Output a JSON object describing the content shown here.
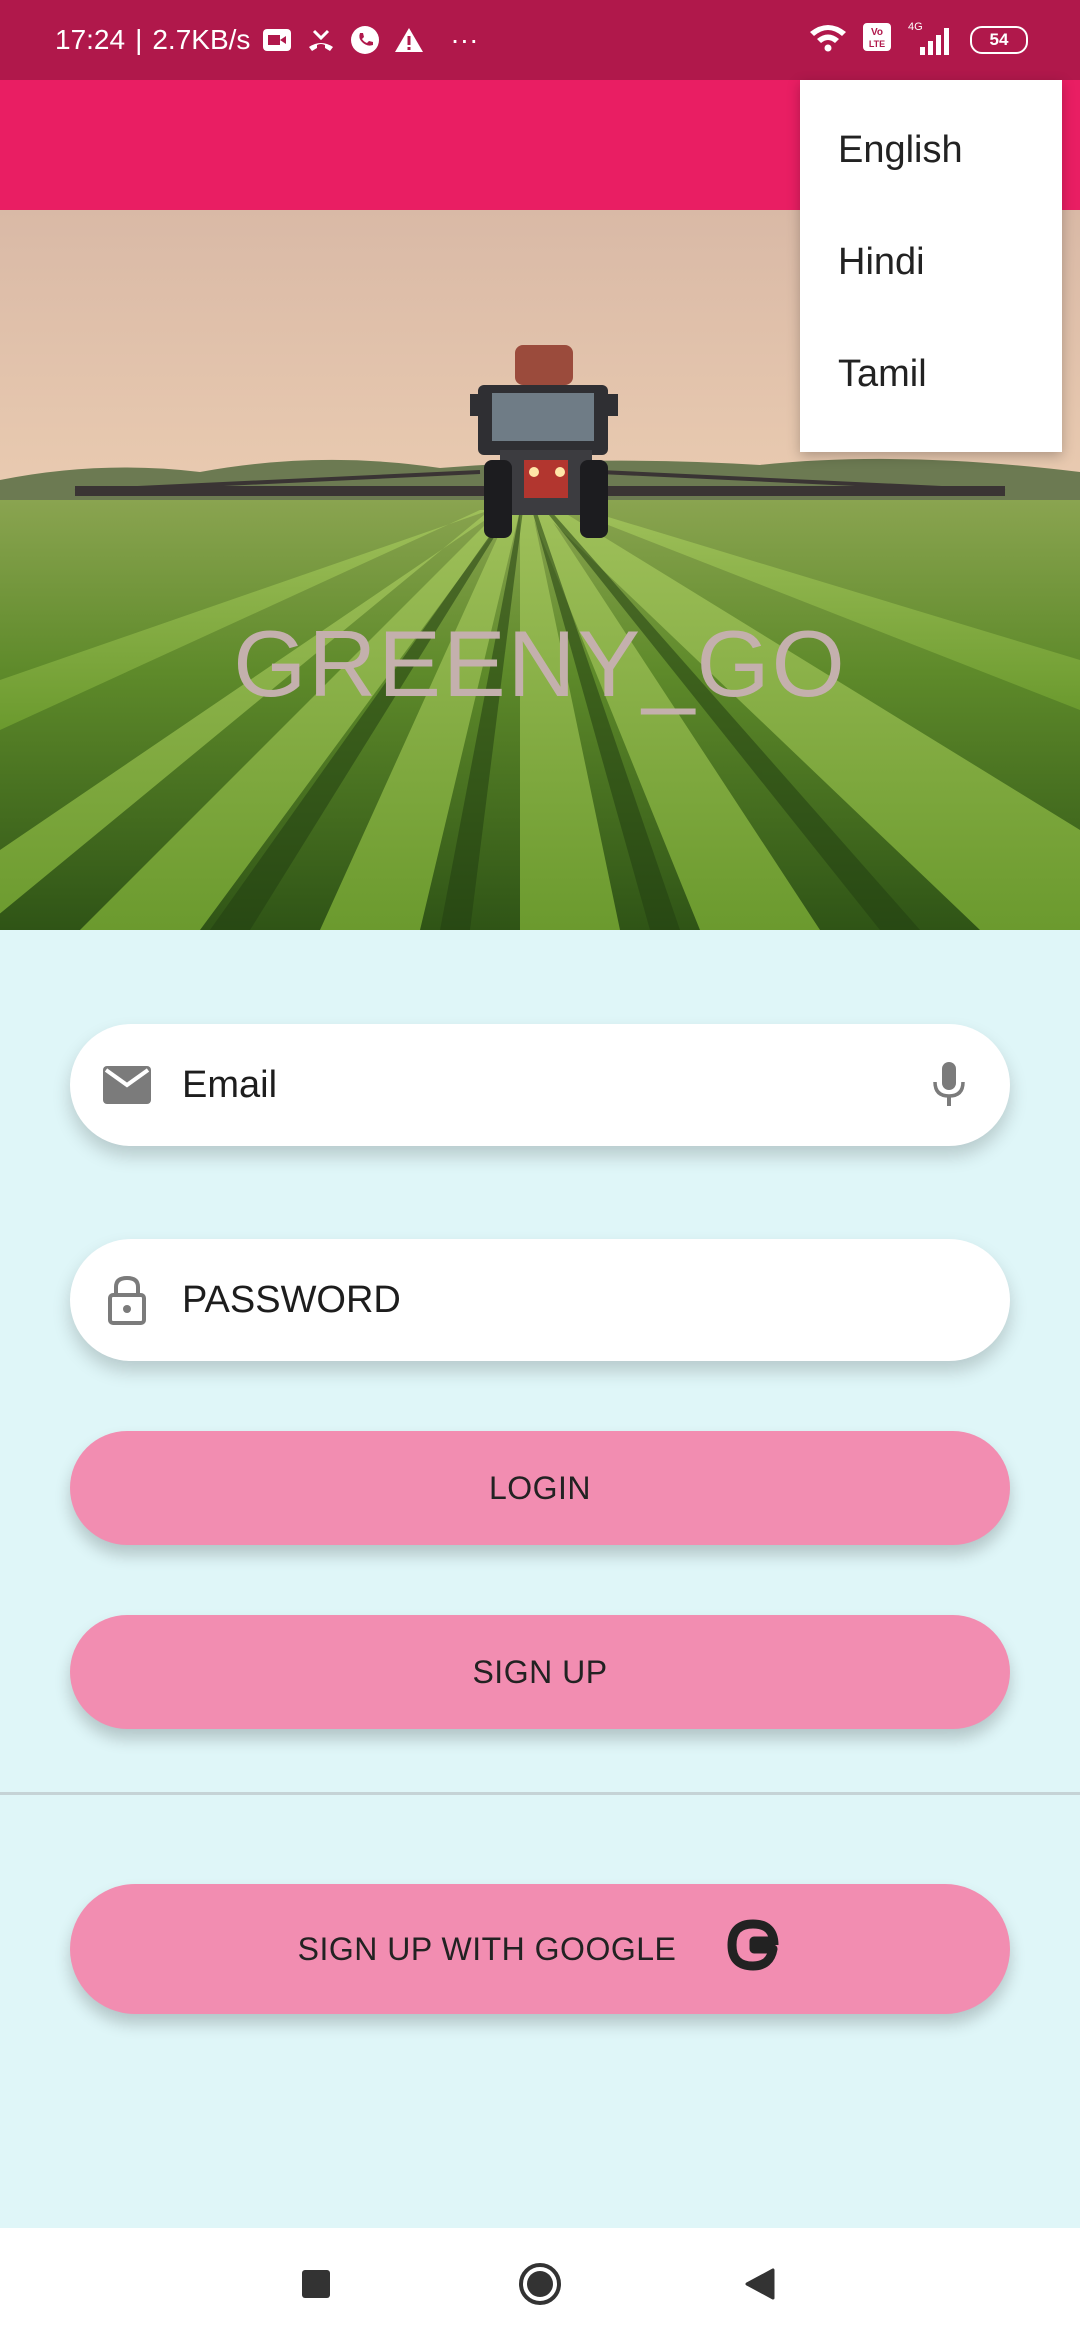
{
  "status_bar": {
    "time": "17:24",
    "speed": "2.7KB/s",
    "more": "···",
    "network_label": "4G",
    "battery": "54"
  },
  "app": {
    "title": "GREENY_GO"
  },
  "language_menu": {
    "items": [
      "English",
      "Hindi",
      "Tamil"
    ]
  },
  "form": {
    "email_placeholder": "Email",
    "password_placeholder": "PASSWORD",
    "login_label": "LOGIN",
    "signup_label": "SIGN UP",
    "google_label": "SIGN UP WITH GOOGLE"
  },
  "colors": {
    "status_bar": "#b0184b",
    "app_bar": "#e91e63",
    "button": "#f28db1",
    "background": "#dff6f8"
  },
  "icons": {
    "email": "email-icon",
    "lock": "lock-icon",
    "mic": "microphone-icon",
    "google": "google-icon",
    "recents": "recents-icon",
    "home": "home-icon",
    "back": "back-icon"
  }
}
